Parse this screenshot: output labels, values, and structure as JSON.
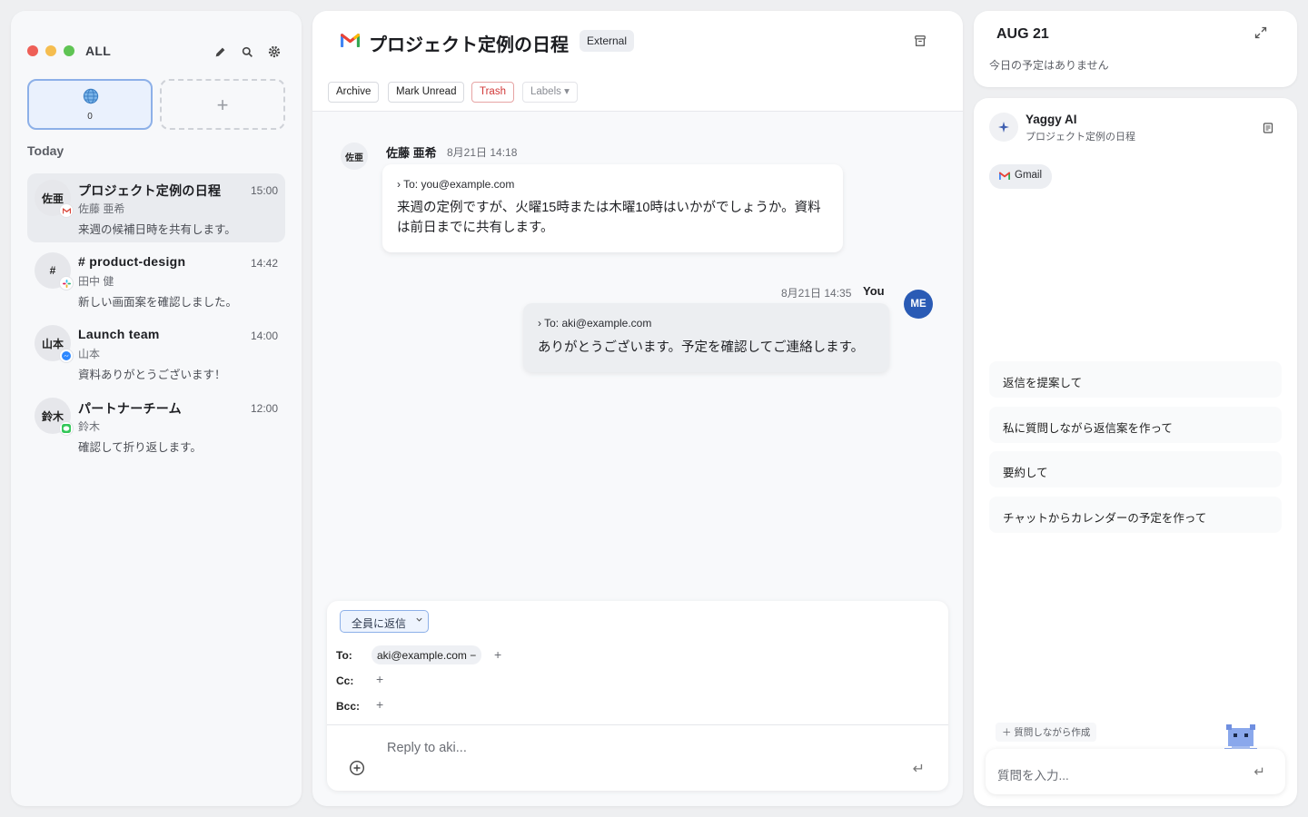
{
  "sidebar": {
    "title": "ALL",
    "accounts": [
      {
        "count": "0"
      }
    ],
    "section_label": "Today",
    "conversations": [
      {
        "avatar": "佐亜",
        "title": "プロジェクト定例の日程",
        "time": "15:00",
        "sender": "佐藤 亜希",
        "preview": "来週の候補日時を共有します。",
        "service": "gmail"
      },
      {
        "avatar": "#",
        "title": "# product-design",
        "time": "14:42",
        "sender": "田中 健",
        "preview": "新しい画面案を確認しました。",
        "service": "slack"
      },
      {
        "avatar": "山本",
        "title": "Launch team",
        "time": "14:00",
        "sender": "山本",
        "preview": "資料ありがとうございます！",
        "service": "messenger"
      },
      {
        "avatar": "鈴木",
        "title": "パートナーチーム",
        "time": "12:00",
        "sender": "鈴木",
        "preview": "確認して折り返します。",
        "service": "imessage"
      }
    ]
  },
  "thread": {
    "subject": "プロジェクト定例の日程",
    "badge": "External",
    "toolbar": {
      "archive": "Archive",
      "mark_unread": "Mark Unread",
      "trash": "Trash",
      "labels": "Labels ▾"
    },
    "messages": [
      {
        "avatar": "佐亜",
        "sender": "佐藤 亜希",
        "time": "8月21日 14:18",
        "to": "› To: you@example.com",
        "body": "来週の定例ですが、火曜15時または木曜10時はいかがでしょうか。資料は前日までに共有します。"
      },
      {
        "avatar": "ME",
        "sender": "You",
        "time": "8月21日 14:35",
        "to": "› To: aki@example.com",
        "body": "ありがとうございます。予定を確認してご連絡します。"
      }
    ]
  },
  "composer": {
    "reply_mode": "全員に返信",
    "to_label": "To:",
    "cc_label": "Cc:",
    "bcc_label": "Bcc:",
    "to_chip": "aki@example.com −",
    "placeholder": "Reply to aki..."
  },
  "calendar": {
    "date": "AUG 21",
    "empty_text": "今日の予定はありません"
  },
  "ai": {
    "name": "Yaggy AI",
    "context": "プロジェクト定例の日程",
    "source_chip": "Gmail",
    "suggestions": [
      "返信を提案して",
      "私に質問しながら返信案を作って",
      "要約して",
      "チャットからカレンダーの予定を作って"
    ],
    "create_with_questions": "＋ 質問しながら作成",
    "input_placeholder": "質問を入力..."
  },
  "colors": {
    "accent": "#8db0e8",
    "me_avatar": "#2a5bb5",
    "trash": "#d13838"
  }
}
